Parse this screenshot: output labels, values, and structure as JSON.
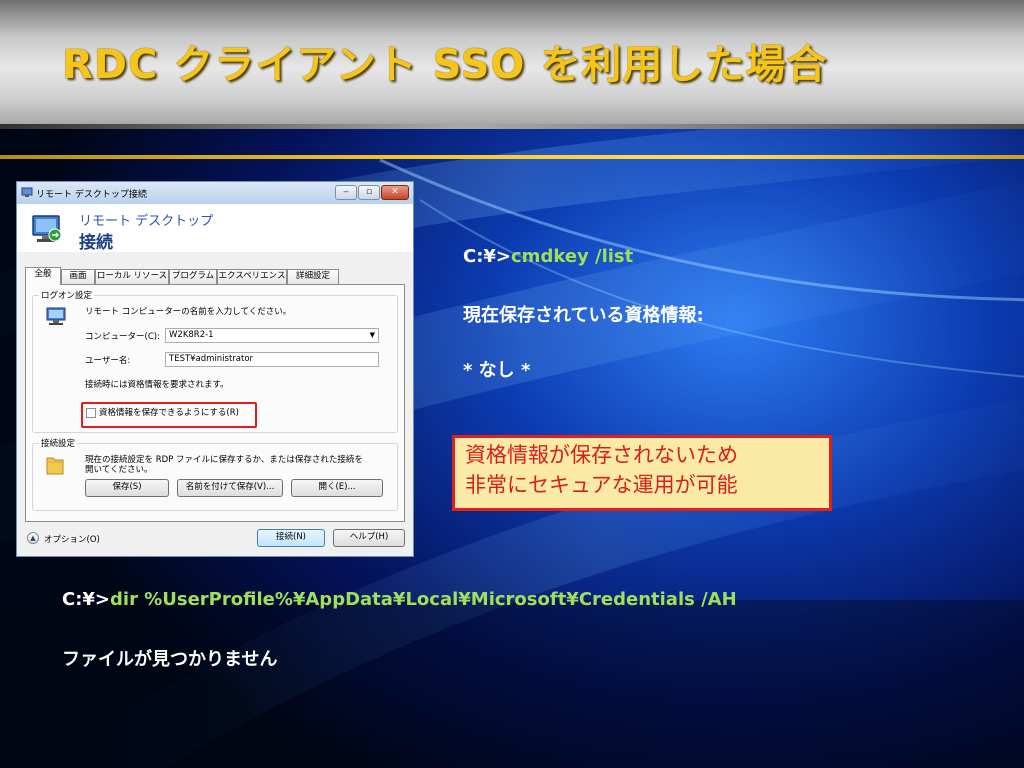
{
  "slide": {
    "title": "RDC クライアント SSO を利用した場合"
  },
  "dialog": {
    "window_title": "リモート デスクトップ接続",
    "window_buttons": {
      "minimize": "‒",
      "maximize": "▫",
      "close": "✕"
    },
    "header_subtitle": "リモート デスクトップ",
    "header_title": "接続",
    "tabs": [
      "全般",
      "画面",
      "ローカル リソース",
      "プログラム",
      "エクスペリエンス",
      "詳細設定"
    ],
    "active_tab": 0,
    "logon_group": {
      "label": "ログオン設定",
      "instruction": "リモート コンピューターの名前を入力してください。",
      "computer_label": "コンピューター(C):",
      "computer_value": "W2K8R2-1",
      "user_label": "ユーザー名:",
      "user_value": "TEST¥administrator",
      "credential_prompt": "接続時には資格情報を要求されます。",
      "save_credentials_label": "資格情報を保存できるようにする(R)",
      "save_credentials_checked": false
    },
    "connection_group": {
      "label": "接続設定",
      "description_line1": "現在の接続設定を RDP ファイルに保存するか、または保存された接続を",
      "description_line2": "開いてください。",
      "save_button": "保存(S)",
      "save_as_button": "名前を付けて保存(V)...",
      "open_button": "開く(E)..."
    },
    "options_label": "オプション(O)",
    "connect_button": "接続(N)",
    "help_button": "ヘルプ(H)"
  },
  "terminal": {
    "prompt": "C:¥>",
    "cmdkey_command": "cmdkey /list",
    "cmdkey_output_header": "現在保存されている資格情報:",
    "cmdkey_output_none": "* なし *",
    "dir_command": "dir %UserProfile%¥AppData¥Local¥Microsoft¥Credentials /AH",
    "dir_output": "ファイルが見つかりません"
  },
  "callout": {
    "line1": "資格情報が保存されないため",
    "line2": "非常にセキュアな運用が可能"
  },
  "colors": {
    "title": "#f6c51a",
    "command_green": "#9fe05a",
    "callout_border": "#e0201c",
    "callout_fill": "#fbe9a6",
    "callout_text": "#d62020",
    "highlight_red": "#e51c1c"
  }
}
